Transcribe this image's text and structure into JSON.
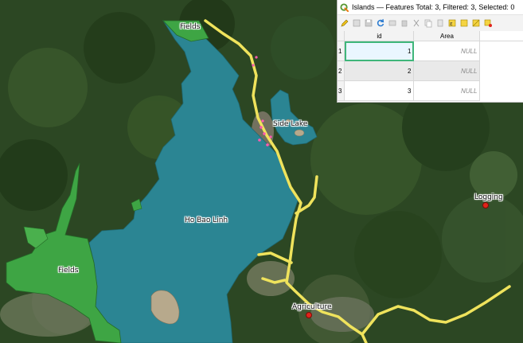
{
  "window": {
    "title": "Islands — Features Total: 3, Filtered: 3, Selected: 0",
    "logo_icon": "qgis-icon"
  },
  "toolbar": {
    "icons": [
      "pencil-icon",
      "multi-edit-icon",
      "save-edits-icon",
      "reload-icon",
      "add-feature-icon",
      "delete-feature-icon",
      "cut-icon",
      "copy-icon",
      "paste-icon",
      "expression-select-icon",
      "select-all-icon",
      "invert-selection-icon",
      "filter-icon"
    ]
  },
  "table": {
    "columns": [
      "id",
      "Area"
    ],
    "rows": [
      {
        "row": "1",
        "id": "1",
        "area": "NULL"
      },
      {
        "row": "2",
        "id": "2",
        "area": "NULL"
      },
      {
        "row": "3",
        "id": "3",
        "area": "NULL"
      }
    ]
  },
  "map": {
    "labels": {
      "fields_top": "Fields",
      "side_lake": "Side Lake",
      "ho_bao_linh": "Ho Bao Linh",
      "fields_left": "Fields",
      "logging": "Logging",
      "agriculture": "Agriculture"
    },
    "colors": {
      "lake": "#2c8795",
      "fields": "#3aa13c",
      "road": "#eee25a",
      "forest": "#2d4a22"
    }
  }
}
